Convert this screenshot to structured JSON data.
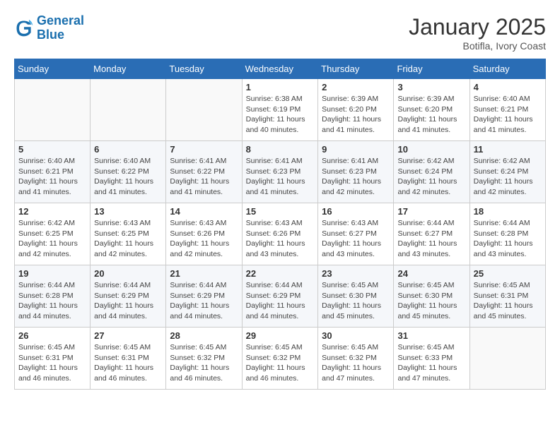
{
  "header": {
    "logo_line1": "General",
    "logo_line2": "Blue",
    "month_year": "January 2025",
    "location": "Botifla, Ivory Coast"
  },
  "days_of_week": [
    "Sunday",
    "Monday",
    "Tuesday",
    "Wednesday",
    "Thursday",
    "Friday",
    "Saturday"
  ],
  "weeks": [
    [
      {
        "day": "",
        "info": ""
      },
      {
        "day": "",
        "info": ""
      },
      {
        "day": "",
        "info": ""
      },
      {
        "day": "1",
        "info": "Sunrise: 6:38 AM\nSunset: 6:19 PM\nDaylight: 11 hours and 40 minutes."
      },
      {
        "day": "2",
        "info": "Sunrise: 6:39 AM\nSunset: 6:20 PM\nDaylight: 11 hours and 41 minutes."
      },
      {
        "day": "3",
        "info": "Sunrise: 6:39 AM\nSunset: 6:20 PM\nDaylight: 11 hours and 41 minutes."
      },
      {
        "day": "4",
        "info": "Sunrise: 6:40 AM\nSunset: 6:21 PM\nDaylight: 11 hours and 41 minutes."
      }
    ],
    [
      {
        "day": "5",
        "info": "Sunrise: 6:40 AM\nSunset: 6:21 PM\nDaylight: 11 hours and 41 minutes."
      },
      {
        "day": "6",
        "info": "Sunrise: 6:40 AM\nSunset: 6:22 PM\nDaylight: 11 hours and 41 minutes."
      },
      {
        "day": "7",
        "info": "Sunrise: 6:41 AM\nSunset: 6:22 PM\nDaylight: 11 hours and 41 minutes."
      },
      {
        "day": "8",
        "info": "Sunrise: 6:41 AM\nSunset: 6:23 PM\nDaylight: 11 hours and 41 minutes."
      },
      {
        "day": "9",
        "info": "Sunrise: 6:41 AM\nSunset: 6:23 PM\nDaylight: 11 hours and 42 minutes."
      },
      {
        "day": "10",
        "info": "Sunrise: 6:42 AM\nSunset: 6:24 PM\nDaylight: 11 hours and 42 minutes."
      },
      {
        "day": "11",
        "info": "Sunrise: 6:42 AM\nSunset: 6:24 PM\nDaylight: 11 hours and 42 minutes."
      }
    ],
    [
      {
        "day": "12",
        "info": "Sunrise: 6:42 AM\nSunset: 6:25 PM\nDaylight: 11 hours and 42 minutes."
      },
      {
        "day": "13",
        "info": "Sunrise: 6:43 AM\nSunset: 6:25 PM\nDaylight: 11 hours and 42 minutes."
      },
      {
        "day": "14",
        "info": "Sunrise: 6:43 AM\nSunset: 6:26 PM\nDaylight: 11 hours and 42 minutes."
      },
      {
        "day": "15",
        "info": "Sunrise: 6:43 AM\nSunset: 6:26 PM\nDaylight: 11 hours and 43 minutes."
      },
      {
        "day": "16",
        "info": "Sunrise: 6:43 AM\nSunset: 6:27 PM\nDaylight: 11 hours and 43 minutes."
      },
      {
        "day": "17",
        "info": "Sunrise: 6:44 AM\nSunset: 6:27 PM\nDaylight: 11 hours and 43 minutes."
      },
      {
        "day": "18",
        "info": "Sunrise: 6:44 AM\nSunset: 6:28 PM\nDaylight: 11 hours and 43 minutes."
      }
    ],
    [
      {
        "day": "19",
        "info": "Sunrise: 6:44 AM\nSunset: 6:28 PM\nDaylight: 11 hours and 44 minutes."
      },
      {
        "day": "20",
        "info": "Sunrise: 6:44 AM\nSunset: 6:29 PM\nDaylight: 11 hours and 44 minutes."
      },
      {
        "day": "21",
        "info": "Sunrise: 6:44 AM\nSunset: 6:29 PM\nDaylight: 11 hours and 44 minutes."
      },
      {
        "day": "22",
        "info": "Sunrise: 6:44 AM\nSunset: 6:29 PM\nDaylight: 11 hours and 44 minutes."
      },
      {
        "day": "23",
        "info": "Sunrise: 6:45 AM\nSunset: 6:30 PM\nDaylight: 11 hours and 45 minutes."
      },
      {
        "day": "24",
        "info": "Sunrise: 6:45 AM\nSunset: 6:30 PM\nDaylight: 11 hours and 45 minutes."
      },
      {
        "day": "25",
        "info": "Sunrise: 6:45 AM\nSunset: 6:31 PM\nDaylight: 11 hours and 45 minutes."
      }
    ],
    [
      {
        "day": "26",
        "info": "Sunrise: 6:45 AM\nSunset: 6:31 PM\nDaylight: 11 hours and 46 minutes."
      },
      {
        "day": "27",
        "info": "Sunrise: 6:45 AM\nSunset: 6:31 PM\nDaylight: 11 hours and 46 minutes."
      },
      {
        "day": "28",
        "info": "Sunrise: 6:45 AM\nSunset: 6:32 PM\nDaylight: 11 hours and 46 minutes."
      },
      {
        "day": "29",
        "info": "Sunrise: 6:45 AM\nSunset: 6:32 PM\nDaylight: 11 hours and 46 minutes."
      },
      {
        "day": "30",
        "info": "Sunrise: 6:45 AM\nSunset: 6:32 PM\nDaylight: 11 hours and 47 minutes."
      },
      {
        "day": "31",
        "info": "Sunrise: 6:45 AM\nSunset: 6:33 PM\nDaylight: 11 hours and 47 minutes."
      },
      {
        "day": "",
        "info": ""
      }
    ]
  ]
}
